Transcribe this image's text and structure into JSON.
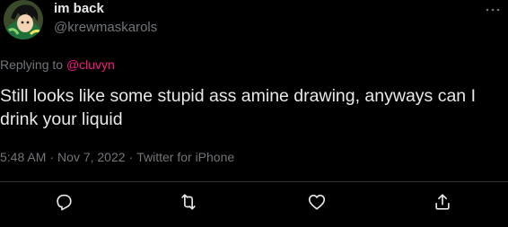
{
  "tweet": {
    "display_name": "im back",
    "handle": "@krewmaskarols",
    "replying_prefix": "Replying to ",
    "replying_to": "@cluvyn",
    "text": "Still looks like some stupid ass amine drawing, anyways can I drink your liquid",
    "time": "5:48 AM",
    "separator": "·",
    "date": "Nov 7, 2022",
    "source": "Twitter for iPhone"
  },
  "icons": {
    "more": "more-options-icon",
    "reply": "reply-icon",
    "retweet": "retweet-icon",
    "like": "like-icon",
    "share": "share-icon"
  },
  "colors": {
    "background": "#000000",
    "primary_text": "#e7e9ea",
    "secondary_text": "#71767b",
    "mention": "#f91880",
    "divider": "#2f3336"
  }
}
